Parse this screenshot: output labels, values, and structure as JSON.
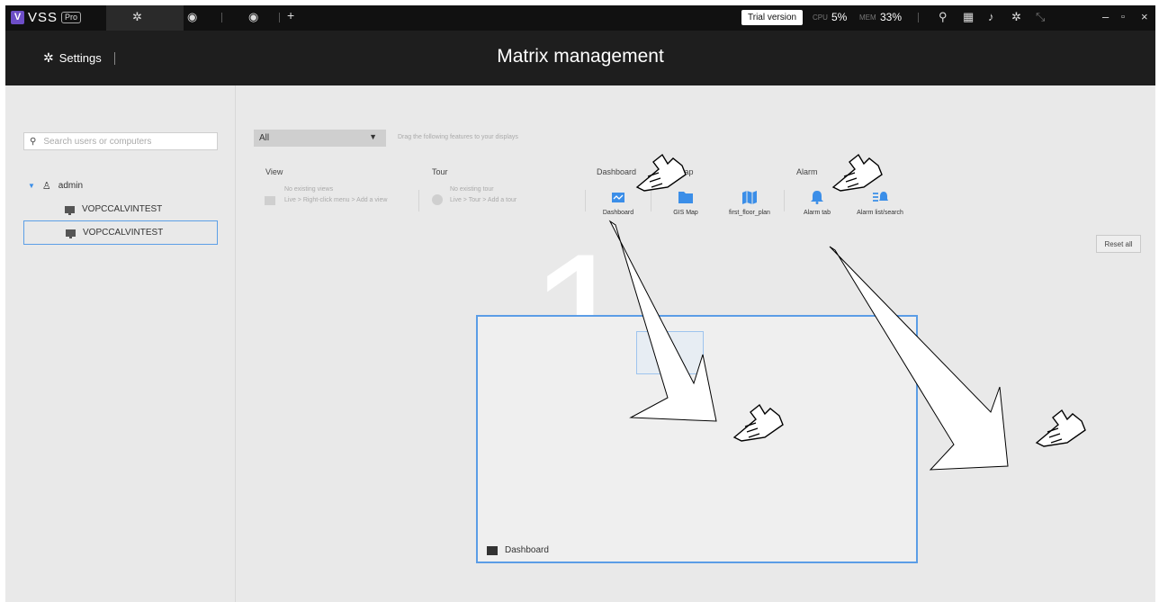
{
  "topbar": {
    "brand": "VSS",
    "edition": "Pro",
    "trial_label": "Trial version",
    "cpu_label": "CPU",
    "cpu_value": "5%",
    "mem_label": "MEM",
    "mem_value": "33%",
    "add_tab": "+",
    "window_min": "–",
    "window_max": "▫",
    "window_close": "×"
  },
  "header": {
    "settings_label": "Settings",
    "title": "Matrix management"
  },
  "left": {
    "search_placeholder": "Search users or computers",
    "admin_label": "admin",
    "computers": [
      "VOPCCALVINTEST",
      "VOPCCALVINTEST"
    ]
  },
  "main": {
    "filter_value": "All",
    "hint": "Drag the following features to your displays",
    "categories": {
      "view": "View",
      "tour": "Tour",
      "dashboard": "Dashboard",
      "map": "Map",
      "alarm": "Alarm"
    },
    "view_empty": [
      "No existing views",
      "Live > Right-click menu > Add a view"
    ],
    "tour_empty": [
      "No existing tour",
      "Live > Tour > Add a tour"
    ],
    "features": [
      "Dashboard",
      "GIS Map",
      "first_floor_plan",
      "Alarm tab",
      "Alarm list/search"
    ],
    "reset_label": "Reset all",
    "display_number": "1",
    "display_content_label": "Dashboard"
  },
  "colors": {
    "accent": "#3b8ee8",
    "topbar": "#111111",
    "header": "#1e1e1e",
    "background": "#e9e9e9"
  }
}
